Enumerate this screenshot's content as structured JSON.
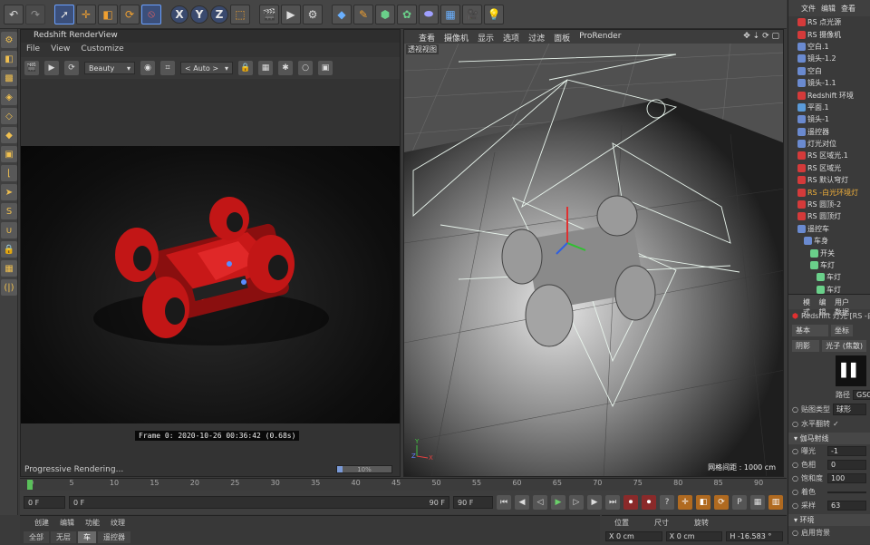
{
  "colors": {
    "accent": "#6aa0ff",
    "highlight": "#f3b13a",
    "red_light": "#e03030",
    "render_bg": "#0e0e0e"
  },
  "toolbar": {
    "icons": [
      "undo-icon",
      "redo-icon",
      "select-icon",
      "move-icon",
      "scale-icon",
      "rotate-icon",
      "recent-tools-icon",
      "x-axis-icon",
      "y-axis-icon",
      "z-axis-icon",
      "coordinate-system-icon",
      "render-view-icon",
      "render-picture-viewer-icon",
      "render-settings-icon",
      "cube-icon",
      "pen-icon",
      "subdivision-icon",
      "array-icon",
      "deformer-icon",
      "floor-icon",
      "camera-icon",
      "light-icon"
    ],
    "x_label": "X",
    "y_label": "Y",
    "z_label": "Z"
  },
  "render_view": {
    "title": "Redshift RenderView",
    "menu": [
      "File",
      "View",
      "Customize"
    ],
    "aov": "Beauty",
    "zoom": "< Auto >",
    "stamp": "Frame  0:  2020-10-26   00:36:42   (0.68s)",
    "status": "Progressive Rendering...",
    "progress_label": "10%",
    "progress": 0.1
  },
  "viewport": {
    "menu": [
      "查看",
      "摄像机",
      "显示",
      "选项",
      "过滤",
      "面板",
      "ProRender"
    ],
    "label": "透视视图",
    "grid_spacing": "网格间距 : 1000 cm"
  },
  "timeline": {
    "ticks": [
      "0",
      "5",
      "10",
      "15",
      "20",
      "25",
      "30",
      "35",
      "40",
      "45",
      "50",
      "55",
      "60",
      "65",
      "70",
      "75",
      "80",
      "85",
      "90"
    ],
    "start_field": "0 F",
    "current_field": "0 F",
    "end_field": "90 F",
    "end_field2": "90 F",
    "right_field": "0 F"
  },
  "materials": {
    "menu": [
      "创建",
      "编辑",
      "功能",
      "纹理"
    ],
    "tabs": [
      "全部",
      "无层",
      "车",
      "遥控器"
    ],
    "active_tab": "车"
  },
  "coordinates": {
    "headers": [
      "位置",
      "尺寸",
      "旋转"
    ],
    "values": [
      "X  0 cm",
      "X  0 cm",
      "H  -16.583 °"
    ]
  },
  "object_manager": {
    "menu": [
      "文件",
      "编辑",
      "查看"
    ],
    "items": [
      {
        "label": "RS 点光源",
        "icon": "#d43a3a",
        "indent": 0,
        "hl": false
      },
      {
        "label": "RS 摄像机",
        "icon": "#d43a3a",
        "indent": 0,
        "hl": false
      },
      {
        "label": "空白.1",
        "icon": "#6a8ad0",
        "indent": 0,
        "hl": false
      },
      {
        "label": "镜头-1.2",
        "icon": "#6a8ad0",
        "indent": 0,
        "hl": false
      },
      {
        "label": "空白",
        "icon": "#6a8ad0",
        "indent": 0,
        "hl": false
      },
      {
        "label": "镜头-1.1",
        "icon": "#6a8ad0",
        "indent": 0,
        "hl": false
      },
      {
        "label": "Redshift 环境",
        "icon": "#d43a3a",
        "indent": 0,
        "hl": false
      },
      {
        "label": "平面.1",
        "icon": "#5a9ad8",
        "indent": 0,
        "hl": false
      },
      {
        "label": "镜头-1",
        "icon": "#6a8ad0",
        "indent": 0,
        "hl": false
      },
      {
        "label": "遥控器",
        "icon": "#6a8ad0",
        "indent": 0,
        "hl": false
      },
      {
        "label": "灯光对位",
        "icon": "#6a8ad0",
        "indent": 0,
        "hl": false
      },
      {
        "label": "RS 区域光.1",
        "icon": "#d43a3a",
        "indent": 0,
        "hl": false
      },
      {
        "label": "RS 区域光",
        "icon": "#d43a3a",
        "indent": 0,
        "hl": false
      },
      {
        "label": "RS 默认穹灯",
        "icon": "#d43a3a",
        "indent": 0,
        "hl": false
      },
      {
        "label": "RS -白光环境灯",
        "icon": "#d43a3a",
        "indent": 0,
        "hl": true
      },
      {
        "label": "RS 圆顶-2",
        "icon": "#d43a3a",
        "indent": 0,
        "hl": false
      },
      {
        "label": "RS 圆顶灯",
        "icon": "#d43a3a",
        "indent": 0,
        "hl": false
      },
      {
        "label": "遥控车",
        "icon": "#6a8ad0",
        "indent": 0,
        "hl": false
      },
      {
        "label": "车身",
        "icon": "#6a8ad0",
        "indent": 1,
        "hl": false
      },
      {
        "label": "开关",
        "icon": "#6ad08a",
        "indent": 2,
        "hl": false
      },
      {
        "label": "车灯",
        "icon": "#6ad08a",
        "indent": 2,
        "hl": false
      },
      {
        "label": "车灯",
        "icon": "#6ad08a",
        "indent": 3,
        "hl": false
      },
      {
        "label": "车灯",
        "icon": "#6ad08a",
        "indent": 3,
        "hl": false
      }
    ]
  },
  "attributes": {
    "menu": [
      "模式",
      "编辑",
      "用户数据"
    ],
    "object_title": "Redshift 灯光 [RS -白",
    "tabs": [
      "基本",
      "坐标",
      "阴影",
      "光子 (焦散)"
    ],
    "path_label": "路径",
    "path_value": "GSG",
    "map_type_label": "贴图类型",
    "map_type_value": "球形",
    "flip_label": "水平翻转",
    "flip_value": "✓",
    "gamma_section": "伽马射线",
    "fields": [
      {
        "label": "曝光",
        "value": "-1"
      },
      {
        "label": "色相",
        "value": "0"
      },
      {
        "label": "饱和度",
        "value": "100"
      },
      {
        "label": "着色",
        "value": ""
      },
      {
        "label": "采样",
        "value": "63"
      }
    ],
    "env_section": "环境",
    "env_field": "启用背景"
  }
}
